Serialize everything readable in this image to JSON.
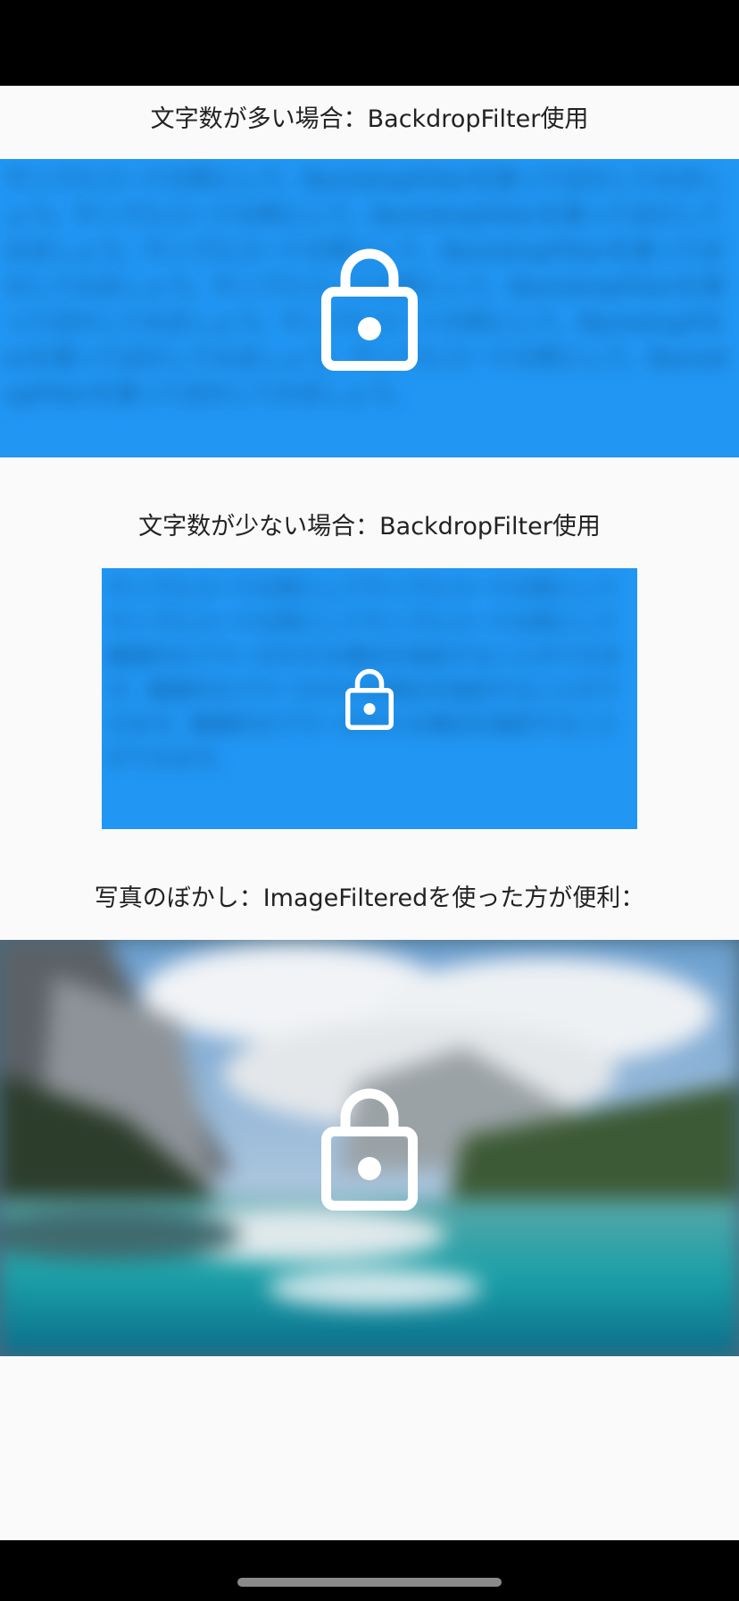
{
  "sections": [
    {
      "title": "文字数が多い場合：BackdropFilter使用",
      "blurred_text": "サンプルコードの例として、BackdropFilterを使ってぼかしてみましょう。サンプルコードの例として、BackdropFilterを使ってぼかしてみましょう。サンプルコードの例として、BackdropFilterを使ってぼかしてみましょう。サンプルコードの例として、BackdropFilterを使ってぼかしてみましょう。サンプルコードの例として、BackdropFilterを使ってぼかしてみましょう。サンプルコードの例として、BackdropFilterを使ってぼかしてみましょう。",
      "panel_color": "#2196f3",
      "icon": "lock-icon"
    },
    {
      "title": "文字数が少ない場合：BackdropFilter使用",
      "blurred_text": "サンプルコードの例としてサンプルコードの例としてサンプルコードの例としてサンプルコードの例として範囲外のブラーがかかる場合を指定することができます。範囲外のブラーがかかる場合を指定することができます。範囲外のブラーがかかる場合を指定することができます。",
      "panel_color": "#2196f3",
      "icon": "lock-icon"
    },
    {
      "title": "写真のぼかし：ImageFilteredを使った方が便利：",
      "image": "blurred mountain lake landscape photo",
      "icon": "lock-icon"
    }
  ],
  "colors": {
    "background": "#fafafa",
    "accent": "#2196f3",
    "system_bars": "#000000",
    "icon": "#ffffff"
  }
}
